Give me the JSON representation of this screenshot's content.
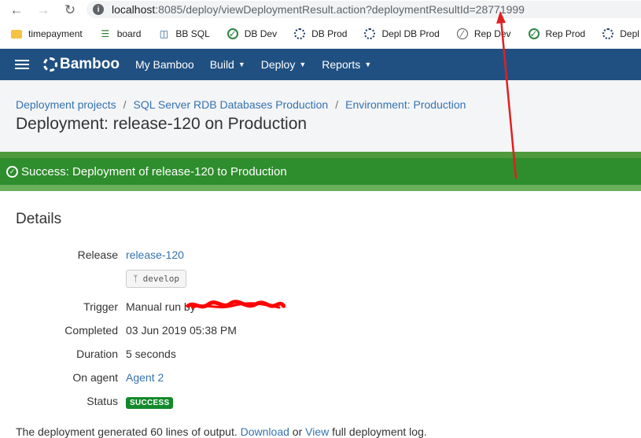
{
  "browser": {
    "url_host": "localhost",
    "url_rest": ":8085/deploy/viewDeploymentResult.action?deploymentResultId=28771999"
  },
  "bookmarks": [
    {
      "label": "timepayment",
      "icon": "folder-icon"
    },
    {
      "label": "board",
      "icon": "board-icon"
    },
    {
      "label": "BB SQL",
      "icon": "database-icon"
    },
    {
      "label": "DB Dev",
      "icon": "check-circle-icon"
    },
    {
      "label": "DB Prod",
      "icon": "bamboo-icon"
    },
    {
      "label": "Depl DB Prod",
      "icon": "bamboo-icon"
    },
    {
      "label": "Rep Dev",
      "icon": "ban-icon"
    },
    {
      "label": "Rep Prod",
      "icon": "check-circle-icon"
    },
    {
      "label": "Depl Rep Pro",
      "icon": "bamboo-icon"
    }
  ],
  "header": {
    "logo": "Bamboo",
    "nav": [
      "My Bamboo",
      "Build",
      "Deploy",
      "Reports"
    ]
  },
  "breadcrumbs": [
    "Deployment projects",
    "SQL Server RDB Databases Production",
    "Environment: Production"
  ],
  "page_title": "Deployment: release-120 on Production",
  "banner": "Success: Deployment of release-120 to Production",
  "details": {
    "title": "Details",
    "release_label": "Release",
    "release_value": "release-120",
    "branch": "develop",
    "trigger_label": "Trigger",
    "trigger_value": "Manual run by",
    "completed_label": "Completed",
    "completed_value": "03 Jun 2019 05:38 PM",
    "duration_label": "Duration",
    "duration_value": "5 seconds",
    "agent_label": "On agent",
    "agent_value": "Agent 2",
    "status_label": "Status",
    "status_value": "SUCCESS"
  },
  "footer": {
    "pre": "The deployment generated 60 lines of output.",
    "download": "Download",
    "or": "or",
    "view": "View",
    "post": "full deployment log."
  },
  "colors": {
    "header_bg": "#205081",
    "banner_bg": "#2e8d2c",
    "link": "#3572b0",
    "success_lozenge": "#14892c",
    "annotation_arrow": "#e02020"
  }
}
